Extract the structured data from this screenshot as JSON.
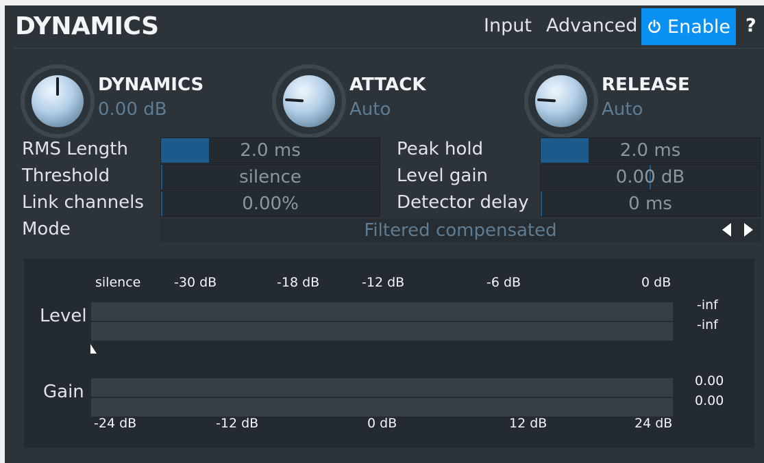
{
  "header": {
    "title": "DYNAMICS",
    "input_label": "Input",
    "advanced_label": "Advanced",
    "enable_label": "Enable",
    "help_label": "?"
  },
  "knobs": [
    {
      "label": "DYNAMICS",
      "value": "0.00 dB",
      "pointer": 0.5
    },
    {
      "label": "ATTACK",
      "value": "Auto",
      "pointer": 0.18
    },
    {
      "label": "RELEASE",
      "value": "Auto",
      "pointer": 0.18
    }
  ],
  "params": {
    "rms_length": {
      "label": "RMS Length",
      "value": "2.0 ms",
      "fill": 0.22
    },
    "threshold": {
      "label": "Threshold",
      "value": "silence",
      "fill": 0.0
    },
    "link_channels": {
      "label": "Link channels",
      "value": "0.00%",
      "fill": 0.0
    },
    "peak_hold": {
      "label": "Peak hold",
      "value": "2.0 ms",
      "fill": 0.22
    },
    "level_gain": {
      "label": "Level gain",
      "value": "0.00 dB",
      "fill": 0.5
    },
    "detector_delay": {
      "label": "Detector delay",
      "value": "0 ms",
      "fill": 0.0
    },
    "mode": {
      "label": "Mode",
      "value": "Filtered compensated"
    }
  },
  "meters": {
    "level_label": "Level",
    "gain_label": "Gain",
    "level_scale": [
      "silence",
      "-30 dB",
      "-18 dB",
      "-12 dB",
      "-6 dB",
      "0 dB"
    ],
    "gain_scale": [
      "-24 dB",
      "-12 dB",
      "0 dB",
      "12 dB",
      "24 dB"
    ],
    "level_values": [
      "-inf",
      "-inf"
    ],
    "gain_values": [
      "0.00",
      "0.00"
    ]
  },
  "colors": {
    "panel": "#2c3339",
    "accent": "#0a8ff2",
    "slider_fill": "#1d5a8c",
    "value_text": "#5e7c93"
  }
}
